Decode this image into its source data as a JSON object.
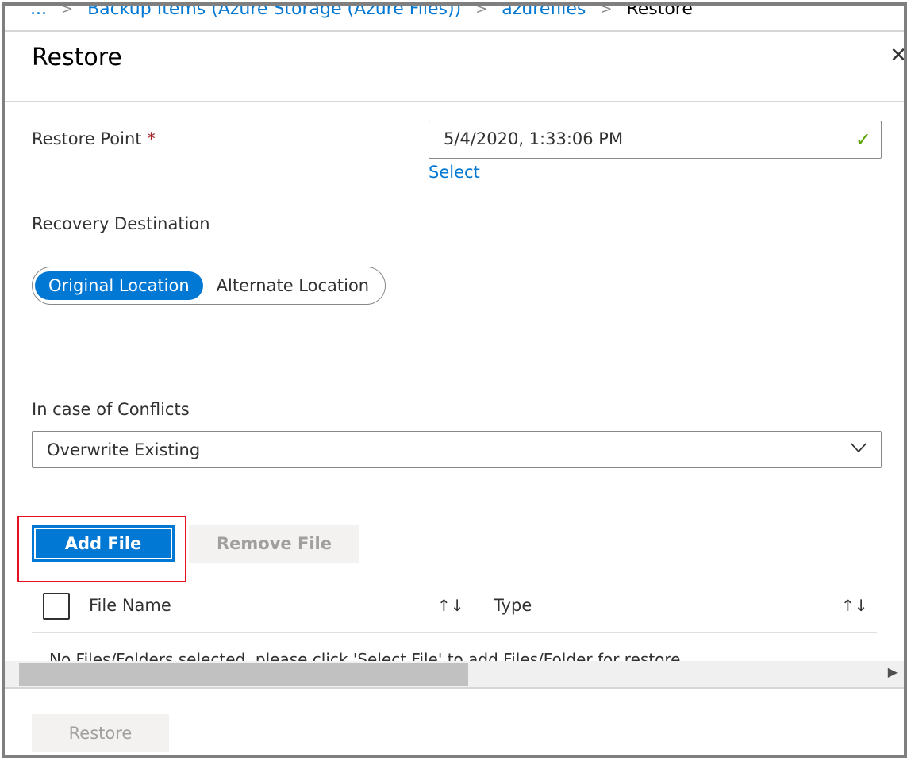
{
  "breadcrumb": {
    "ellipsis": "...",
    "items": [
      "Backup Items (Azure Storage (Azure Files))",
      "azurefiles"
    ],
    "current": "Restore"
  },
  "panel": {
    "title": "Restore",
    "close_icon": "close-icon"
  },
  "restore_point": {
    "label": "Restore Point",
    "required": "*",
    "value": "5/4/2020, 1:33:06 PM",
    "select_link": "Select",
    "valid_color": "#57a300"
  },
  "recovery_destination": {
    "label": "Recovery Destination",
    "options": [
      "Original Location",
      "Alternate Location"
    ],
    "selected": "Original Location"
  },
  "conflicts": {
    "label": "In case of Conflicts",
    "value": "Overwrite Existing"
  },
  "buttons": {
    "add_file": "Add File",
    "remove_file": "Remove File",
    "restore": "Restore"
  },
  "table": {
    "columns": [
      "File Name",
      "Type"
    ],
    "sort_icon": "↑↓",
    "empty_message": "No Files/Folders selected, please click 'Select File' to add Files/Folder for restore"
  },
  "colors": {
    "accent": "#0078d4",
    "highlight": "#e81123"
  }
}
